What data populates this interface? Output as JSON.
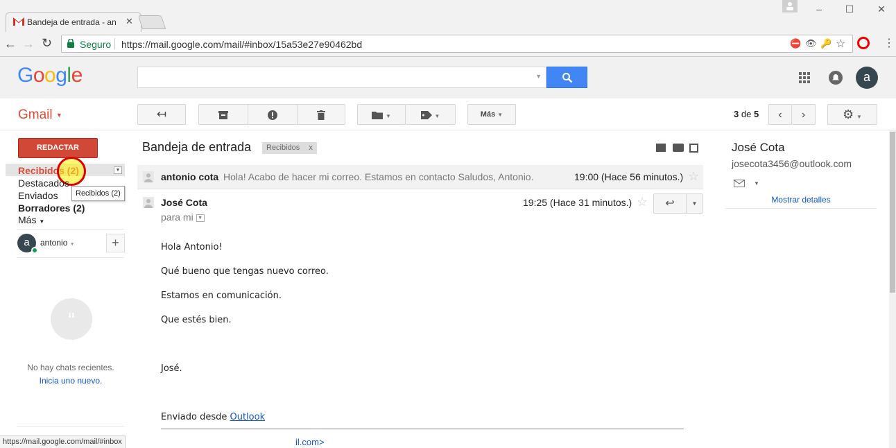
{
  "browser": {
    "tab_title": "Bandeja de entrada - an",
    "secure_label": "Seguro",
    "url": "https://mail.google.com/mail/#inbox/15a53e27e90462bd",
    "status_url": "https://mail.google.com/mail/#inbox"
  },
  "header": {
    "logo": "Google",
    "avatar_letter": "a"
  },
  "gmail": {
    "label": "Gmail",
    "more_label": "Más",
    "page_current": "3",
    "page_of": "de",
    "page_total": "5"
  },
  "nav": {
    "compose": "REDACTAR",
    "inbox": "Recibidos (2)",
    "starred": "Destacados",
    "sent": "Enviados",
    "drafts": "Borradores (2)",
    "more": "Más",
    "tooltip": "Recibidos (2)",
    "user_name": "antonio",
    "user_letter": "a",
    "no_chats": "No hay chats recientes.",
    "start_chat": "Inicia uno nuevo."
  },
  "thread": {
    "title": "Bandeja de entrada",
    "label_chip": "Recibidos",
    "label_chip_close": "x",
    "collapsed": {
      "sender": "antonio cota",
      "snippet": "Hola! Acabo de hacer mi correo. Estamos en contacto Saludos, Antonio.",
      "time": "19:00 (Hace 56 minutos.)"
    },
    "expanded": {
      "sender": "José Cota",
      "time": "19:25 (Hace 31 minutos.)",
      "to": "para mi",
      "body": [
        "Hola Antonio!",
        "Qué bueno que tengas nuevo correo.",
        "Estamos en comunicación.",
        "Que estés bien.",
        "José."
      ],
      "signature_prefix": "Enviado desde",
      "signature_link": "Outlook",
      "cut_text": "il.com>"
    }
  },
  "contact": {
    "name": "José Cota",
    "email": "josecota3456@outlook.com",
    "details_link": "Mostrar detalles"
  },
  "colors": {
    "accent_red": "#d14836",
    "gmail_red": "#dd4b39",
    "search_blue": "#4285f4",
    "link_blue": "#15c"
  }
}
